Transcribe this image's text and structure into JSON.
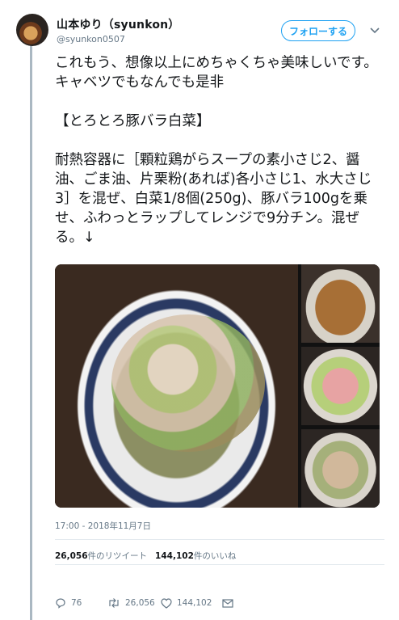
{
  "user": {
    "name": "山本ゆり（syunkon）",
    "handle": "@syunkon0507"
  },
  "follow_button": "フォローする",
  "tweet_text": "これもう、想像以上にめちゃくちゃ美味しいです。キャベツでもなんでも是非\n\n【とろとろ豚バラ白菜】\n\n耐熱容器に［顆粒鶏がらスープの素小さじ2、醤油、ごま油、片栗粉(あれば)各小さじ1、水大さじ3］を混ぜ、白菜1/8個(250g)、豚バラ100gを乗せ、ふわっとラップしてレンジで9分チン。混ぜる。↓",
  "timestamp": "17:00 - 2018年11月7日",
  "stats": {
    "retweets_count": "26,056",
    "retweets_label": "件のリツイート",
    "likes_count": "144,102",
    "likes_label": "件のいいね"
  },
  "actions": {
    "replies": "76",
    "retweets": "26,056",
    "likes": "144,102"
  },
  "icons": [
    "caret-down-icon",
    "reply-icon",
    "retweet-icon",
    "like-icon",
    "dm-icon"
  ],
  "colors": {
    "accent": "#1da1f2",
    "muted": "#657786",
    "text": "#14171a"
  }
}
